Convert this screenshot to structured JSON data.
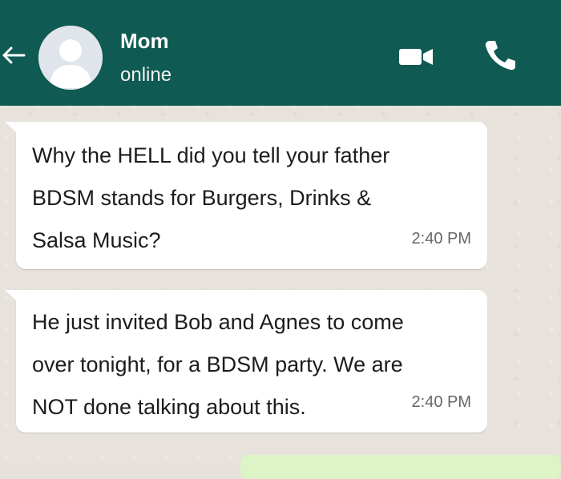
{
  "header": {
    "contact_name": "Mom",
    "status": "online",
    "background_color": "#0f5a52",
    "icons": [
      "back-arrow-icon",
      "avatar-placeholder",
      "video-call-icon",
      "voice-call-icon"
    ]
  },
  "messages": [
    {
      "text": "Why the HELL did you tell your father\nBDSM stands for Burgers, Drinks &\nSalsa Music?",
      "time": "2:40 PM"
    },
    {
      "text": "He just invited Bob and Agnes to come\nover tonight, for a BDSM party. We are\nNOT done talking about this.",
      "time": "2:40 PM"
    }
  ]
}
